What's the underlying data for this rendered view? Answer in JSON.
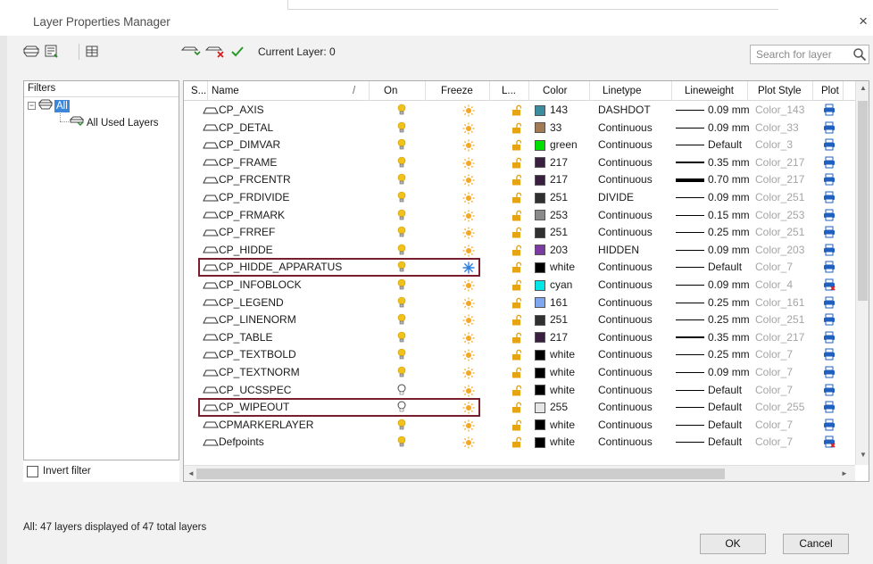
{
  "window": {
    "title": "Layer Properties Manager",
    "close_glyph": "×"
  },
  "toolbar": {
    "current_layer": "Current Layer: 0",
    "search_placeholder": "Search for layer"
  },
  "filters": {
    "header": "Filters",
    "expander": "−",
    "all_label": "All",
    "used_label": "All Used Layers",
    "invert_label": "Invert filter"
  },
  "columns": {
    "status": "S...",
    "name": "Name",
    "on": "On",
    "freeze": "Freeze",
    "lock": "L...",
    "color": "Color",
    "linetype": "Linetype",
    "lineweight": "Lineweight",
    "plot_style": "Plot Style",
    "plot": "Plot",
    "sort_marker": "/"
  },
  "colors": {
    "bulb_on": "#f2c21b",
    "bulb_off": "#ffffff",
    "sun": "#f5a623",
    "snowflake": "#2f7fe0",
    "lock": "#e6a412",
    "plot_icon": "#1f5fbf",
    "highlight": "#7a1d2c",
    "selection": "#3b86d8"
  },
  "layers": [
    {
      "name": "CP_AXIS",
      "on": true,
      "frozen": false,
      "color_label": "143",
      "swatch": "#3c8ca0",
      "linetype": "DASHDOT",
      "lineweight": "0.09 mm",
      "lw": 1,
      "plot_style": "Color_143",
      "plot_disabled": false
    },
    {
      "name": "CP_DETAL",
      "on": true,
      "frozen": false,
      "color_label": "33",
      "swatch": "#a27a53",
      "linetype": "Continuous",
      "lineweight": "0.09 mm",
      "lw": 1,
      "plot_style": "Color_33",
      "plot_disabled": false
    },
    {
      "name": "CP_DIMVAR",
      "on": true,
      "frozen": false,
      "color_label": "green",
      "swatch": "#00e000",
      "linetype": "Continuous",
      "lineweight": "Default",
      "lw": 1,
      "plot_style": "Color_3",
      "plot_disabled": false
    },
    {
      "name": "CP_FRAME",
      "on": true,
      "frozen": false,
      "color_label": "217",
      "swatch": "#3a2040",
      "linetype": "Continuous",
      "lineweight": "0.35 mm",
      "lw": 2,
      "plot_style": "Color_217",
      "plot_disabled": false
    },
    {
      "name": "CP_FRCENTR",
      "on": true,
      "frozen": false,
      "color_label": "217",
      "swatch": "#3a2040",
      "linetype": "Continuous",
      "lineweight": "0.70 mm",
      "lw": 4,
      "plot_style": "Color_217",
      "plot_disabled": false
    },
    {
      "name": "CP_FRDIVIDE",
      "on": true,
      "frozen": false,
      "color_label": "251",
      "swatch": "#303030",
      "linetype": "DIVIDE",
      "lineweight": "0.09 mm",
      "lw": 1,
      "plot_style": "Color_251",
      "plot_disabled": false
    },
    {
      "name": "CP_FRMARK",
      "on": true,
      "frozen": false,
      "color_label": "253",
      "swatch": "#8a8a8a",
      "linetype": "Continuous",
      "lineweight": "0.15 mm",
      "lw": 1,
      "plot_style": "Color_253",
      "plot_disabled": false
    },
    {
      "name": "CP_FRREF",
      "on": true,
      "frozen": false,
      "color_label": "251",
      "swatch": "#303030",
      "linetype": "Continuous",
      "lineweight": "0.25 mm",
      "lw": 1,
      "plot_style": "Color_251",
      "plot_disabled": false
    },
    {
      "name": "CP_HIDDE",
      "on": true,
      "frozen": false,
      "color_label": "203",
      "swatch": "#7a3aa0",
      "linetype": "HIDDEN",
      "lineweight": "0.09 mm",
      "lw": 1,
      "plot_style": "Color_203",
      "plot_disabled": false
    },
    {
      "name": "CP_HIDDE_APPARATUS",
      "on": true,
      "frozen": true,
      "color_label": "white",
      "swatch": "#000000",
      "linetype": "Continuous",
      "lineweight": "Default",
      "lw": 1,
      "plot_style": "Color_7",
      "plot_disabled": false
    },
    {
      "name": "CP_INFOBLOCK",
      "on": true,
      "frozen": false,
      "color_label": "cyan",
      "swatch": "#00e5e5",
      "linetype": "Continuous",
      "lineweight": "0.09 mm",
      "lw": 1,
      "plot_style": "Color_4",
      "plot_disabled": true
    },
    {
      "name": "CP_LEGEND",
      "on": true,
      "frozen": false,
      "color_label": "161",
      "swatch": "#7fa6ef",
      "linetype": "Continuous",
      "lineweight": "0.25 mm",
      "lw": 1,
      "plot_style": "Color_161",
      "plot_disabled": false
    },
    {
      "name": "CP_LINENORM",
      "on": true,
      "frozen": false,
      "color_label": "251",
      "swatch": "#303030",
      "linetype": "Continuous",
      "lineweight": "0.25 mm",
      "lw": 1,
      "plot_style": "Color_251",
      "plot_disabled": false
    },
    {
      "name": "CP_TABLE",
      "on": true,
      "frozen": false,
      "color_label": "217",
      "swatch": "#3a2040",
      "linetype": "Continuous",
      "lineweight": "0.35 mm",
      "lw": 2,
      "plot_style": "Color_217",
      "plot_disabled": false
    },
    {
      "name": "CP_TEXTBOLD",
      "on": true,
      "frozen": false,
      "color_label": "white",
      "swatch": "#000000",
      "linetype": "Continuous",
      "lineweight": "0.25 mm",
      "lw": 1,
      "plot_style": "Color_7",
      "plot_disabled": false
    },
    {
      "name": "CP_TEXTNORM",
      "on": true,
      "frozen": false,
      "color_label": "white",
      "swatch": "#000000",
      "linetype": "Continuous",
      "lineweight": "0.09 mm",
      "lw": 1,
      "plot_style": "Color_7",
      "plot_disabled": false
    },
    {
      "name": "CP_UCSSPEC",
      "on": false,
      "frozen": false,
      "color_label": "white",
      "swatch": "#000000",
      "linetype": "Continuous",
      "lineweight": "Default",
      "lw": 1,
      "plot_style": "Color_7",
      "plot_disabled": false
    },
    {
      "name": "CP_WIPEOUT",
      "on": false,
      "frozen": false,
      "color_label": "255",
      "swatch": "#e6e6e6",
      "linetype": "Continuous",
      "lineweight": "Default",
      "lw": 1,
      "plot_style": "Color_255",
      "plot_disabled": false
    },
    {
      "name": "CPMARKERLAYER",
      "on": true,
      "frozen": false,
      "color_label": "white",
      "swatch": "#000000",
      "linetype": "Continuous",
      "lineweight": "Default",
      "lw": 1,
      "plot_style": "Color_7",
      "plot_disabled": false
    },
    {
      "name": "Defpoints",
      "on": true,
      "frozen": false,
      "color_label": "white",
      "swatch": "#000000",
      "linetype": "Continuous",
      "lineweight": "Default",
      "lw": 1,
      "plot_style": "Color_7",
      "plot_disabled": true
    }
  ],
  "highlighted_layers": [
    "CP_HIDDE_APPARATUS",
    "CP_WIPEOUT"
  ],
  "status_text": "All:  47 layers displayed of 47 total layers",
  "buttons": {
    "ok": "OK",
    "cancel": "Cancel"
  },
  "scroll": {
    "left_arrow": "◄",
    "right_arrow": "►",
    "up_arrow": "▲",
    "down_arrow": "▼"
  }
}
